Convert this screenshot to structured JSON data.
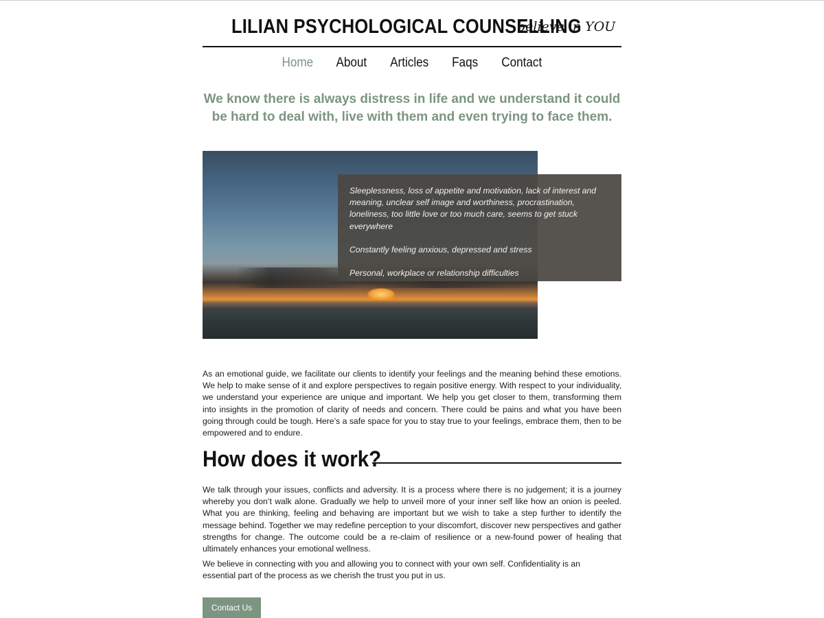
{
  "header": {
    "title": "LILIAN PSYCHOLOGICAL COUNSELLING",
    "tagline": "believe in YOU"
  },
  "nav": {
    "items": [
      "Home",
      "About",
      "Articles",
      "Faqs",
      "Contact"
    ],
    "active": "Home"
  },
  "intro": {
    "lead": "We know there is always distress in life and we understand it could be hard to deal with, live with them and even trying to face them."
  },
  "hero": {
    "overlay_lines": [
      "Sleeplessness, loss of appetite and motivation, lack of interest and meaning, unclear self image and worthiness, procrastination, loneliness, too little love or too much care, seems to get stuck everywhere",
      "Constantly feeling anxious, depressed and stress",
      "Personal, workplace or relationship difficulties"
    ]
  },
  "content": {
    "paragraph1": "As an emotional guide, we facilitate our clients to identify your feelings and the meaning behind these emotions. We help to make sense of it and explore perspectives to regain positive energy. With respect to your individuality, we understand your experience are unique and important.  We help you get closer to them, transforming them into insights in the promotion of clarity of needs and concern. There could be pains and what you have been going through could be tough. Here’s a safe space for you to stay true to your feelings, embrace them, then to be empowered and to endure.",
    "section_heading": "How does it work?",
    "paragraph2": "We talk through your issues, conflicts and adversity. It is a process where there is no judgement; it is a journey whereby you don’t walk alone. Gradually we help to unveil more of your inner self like how an onion is peeled.  What you are thinking, feeling and behaving are important but we wish to take a step further to identify the message behind. Together we may redefine perception to your discomfort, discover new perspectives and gather strengths for change. The outcome could be a re-claim of resilience or a new-found power of healing that ultimately enhances your emotional wellness.",
    "paragraph3": "We believe in connecting with you and allowing you to connect with your own self. Confidentiality is an essential part of the process as we cherish the trust you put in us.",
    "cta_label": "Contact Us"
  },
  "colors": {
    "accent": "#7b9581",
    "text": "#1a1a1a",
    "overlay": "#4a4742"
  }
}
